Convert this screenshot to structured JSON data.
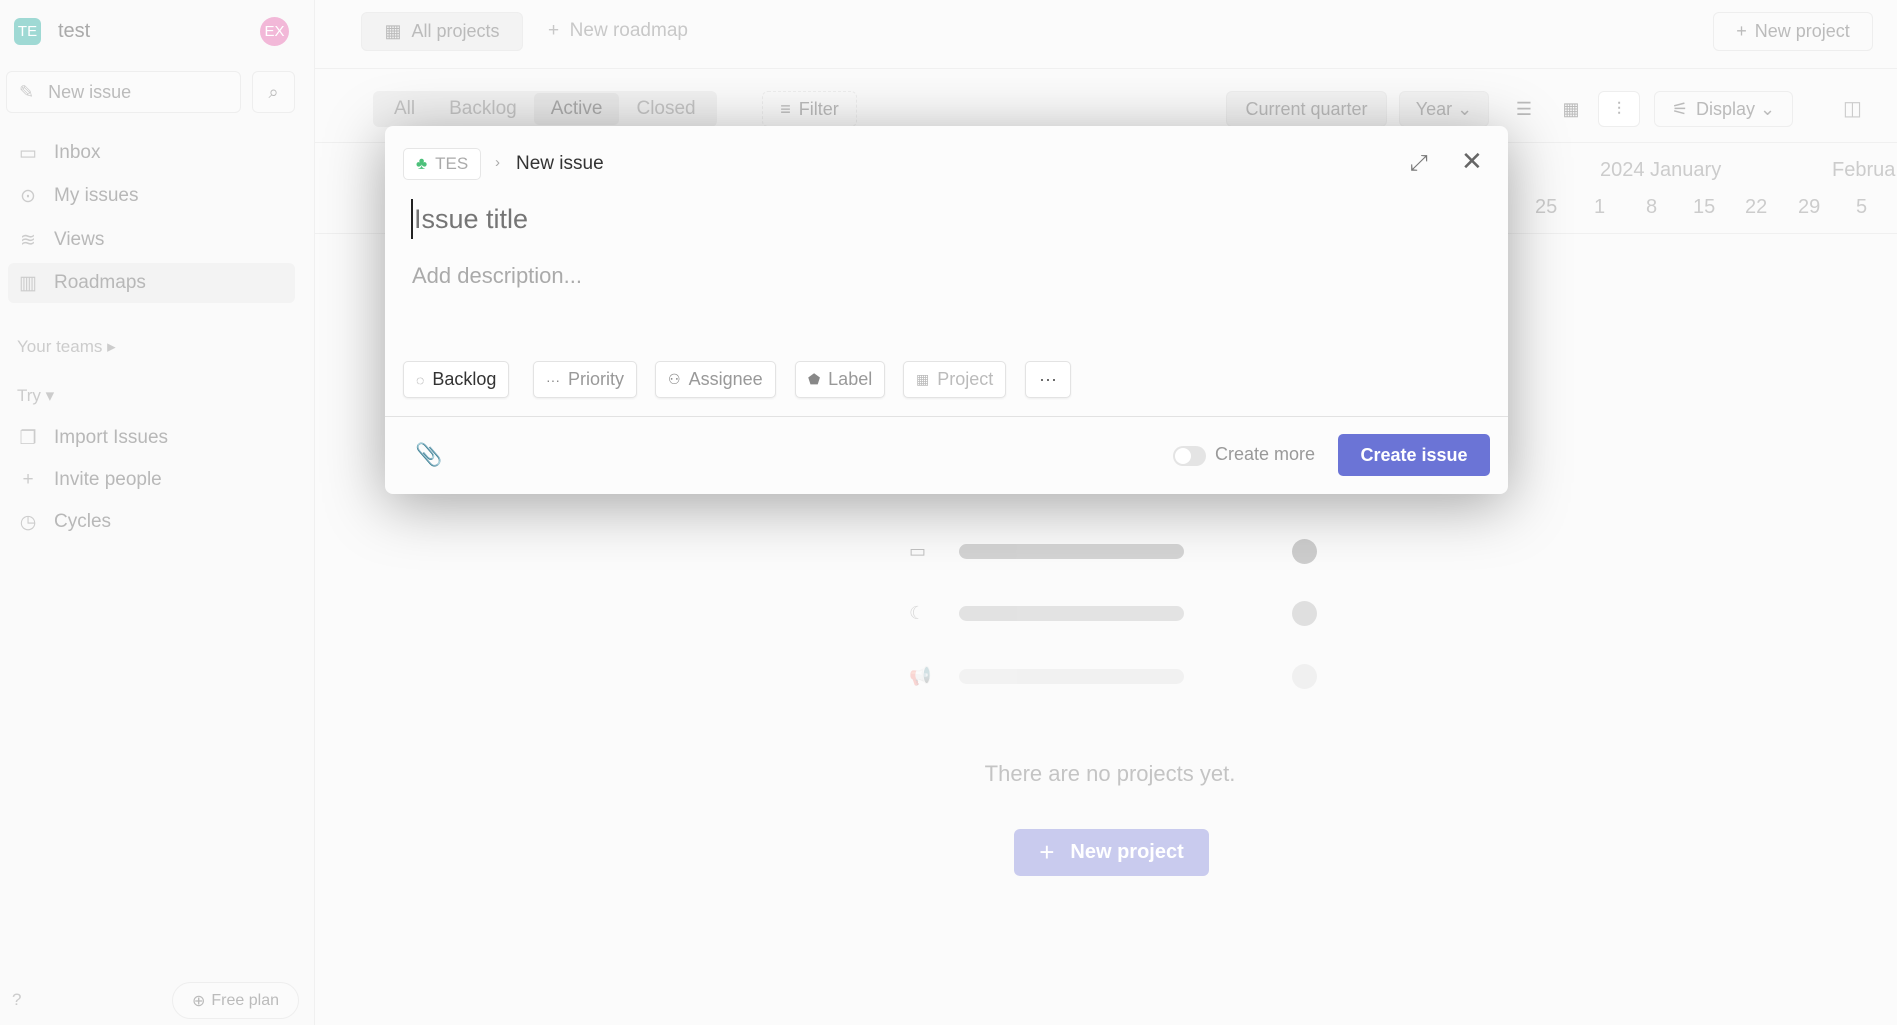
{
  "workspace": {
    "initials": "TE",
    "name": "test",
    "avatar": "EX",
    "badge_color": "#9fd9d4",
    "avatar_color": "#f2b8d8"
  },
  "sidebar": {
    "new_issue": "New issue",
    "items": [
      {
        "label": "Inbox",
        "icon": "inbox-icon"
      },
      {
        "label": "My issues",
        "icon": "target-icon"
      },
      {
        "label": "Views",
        "icon": "layers-icon"
      },
      {
        "label": "Roadmaps",
        "icon": "map-icon"
      }
    ],
    "your_teams": "Your teams",
    "try": "Try",
    "try_items": [
      {
        "label": "Import Issues",
        "icon": "import-icon"
      },
      {
        "label": "Invite people",
        "icon": "plus-icon"
      },
      {
        "label": "Cycles",
        "icon": "cycle-icon"
      }
    ],
    "help": "?",
    "plan": "Free plan"
  },
  "topbar": {
    "all_projects": "All projects",
    "new_roadmap": "New roadmap",
    "new_project": "New project"
  },
  "toolbar": {
    "tabs": [
      "All",
      "Backlog",
      "Active",
      "Closed"
    ],
    "active_tab": "Active",
    "filter": "Filter",
    "current_quarter": "Current quarter",
    "year": "Year",
    "display": "Display"
  },
  "timeline": {
    "month1": "2024 January",
    "month2": "Februa",
    "days": [
      "25",
      "1",
      "8",
      "15",
      "22",
      "29",
      "5"
    ]
  },
  "empty": {
    "message": "There are no projects yet.",
    "button": "New project"
  },
  "modal": {
    "team": "TES",
    "breadcrumb": "New issue",
    "title_placeholder": "Issue title",
    "description_placeholder": "Add description...",
    "chips": [
      "Backlog",
      "Priority",
      "Assignee",
      "Label",
      "Project"
    ],
    "create_more": "Create more",
    "create_button": "Create issue",
    "accent": "#6b74d6"
  }
}
